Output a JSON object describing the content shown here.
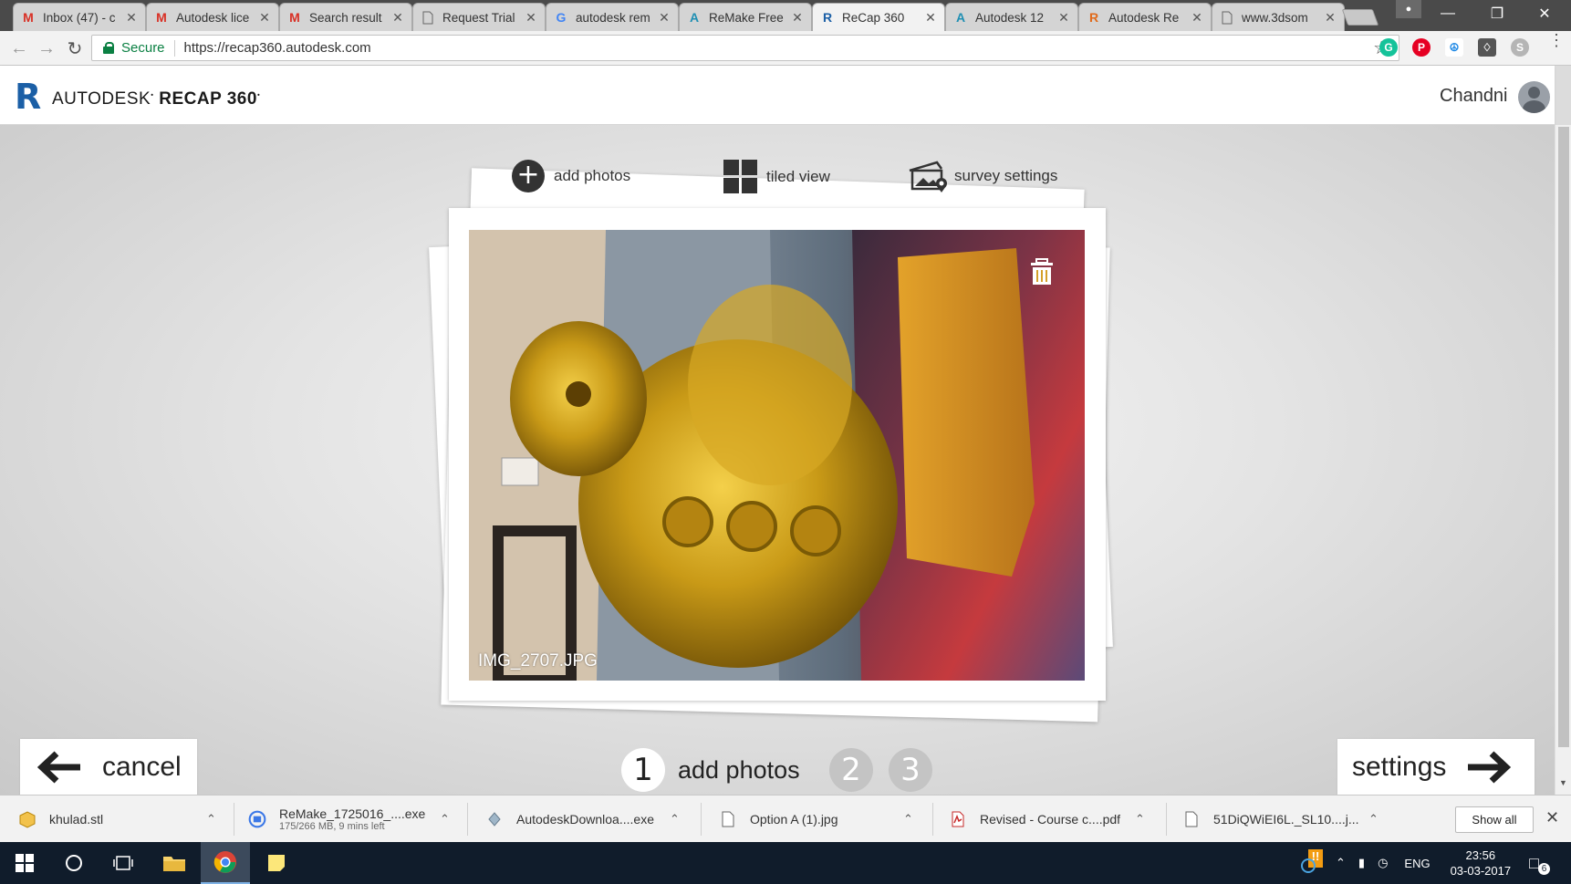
{
  "browser": {
    "tabs": [
      {
        "label": "Inbox (47) - c",
        "favicon": "gmail-icon"
      },
      {
        "label": "Autodesk lice",
        "favicon": "gmail-icon"
      },
      {
        "label": "Search result",
        "favicon": "gmail-icon"
      },
      {
        "label": "Request Trial",
        "favicon": "page-icon"
      },
      {
        "label": "autodesk rem",
        "favicon": "google-icon"
      },
      {
        "label": "ReMake Free",
        "favicon": "autodesk-icon"
      },
      {
        "label": "ReCap 360",
        "favicon": "recap-icon",
        "active": true
      },
      {
        "label": "Autodesk 12",
        "favicon": "autodesk-icon"
      },
      {
        "label": "Autodesk Re",
        "favicon": "recap-icon"
      },
      {
        "label": "www.3dsom",
        "favicon": "page-icon"
      }
    ],
    "secure_label": "Secure",
    "url": "https://recap360.autodesk.com"
  },
  "app": {
    "brand_prefix": "AUTODESK",
    "brand_product": "RECAP 360",
    "user_name": "Chandni"
  },
  "toolbar": {
    "add_photos": "add photos",
    "tiled_view": "tiled view",
    "survey_settings": "survey settings"
  },
  "photo": {
    "filename": "IMG_2707.JPG"
  },
  "footer_nav": {
    "cancel": "cancel",
    "settings": "settings",
    "steps": [
      "1",
      "2",
      "3"
    ],
    "current_step_label": "add photos"
  },
  "downloads": {
    "items": [
      {
        "name": "khulad.stl",
        "sub": ""
      },
      {
        "name": "ReMake_1725016_....exe",
        "sub": "175/266 MB, 9 mins left"
      },
      {
        "name": "AutodeskDownloa....exe",
        "sub": ""
      },
      {
        "name": "Option A (1).jpg",
        "sub": ""
      },
      {
        "name": "Revised - Course c....pdf",
        "sub": ""
      },
      {
        "name": "51DiQWiEI6L._SL10....j...",
        "sub": ""
      }
    ],
    "show_all": "Show all"
  },
  "taskbar": {
    "language": "ENG",
    "time": "23:56",
    "date": "03-03-2017",
    "notification_count": "6"
  },
  "colors": {
    "brand_blue": "#1b5fa6",
    "secure_green": "#0b8043",
    "taskbar": "#101c2b",
    "stage": "#e4e4e4"
  }
}
